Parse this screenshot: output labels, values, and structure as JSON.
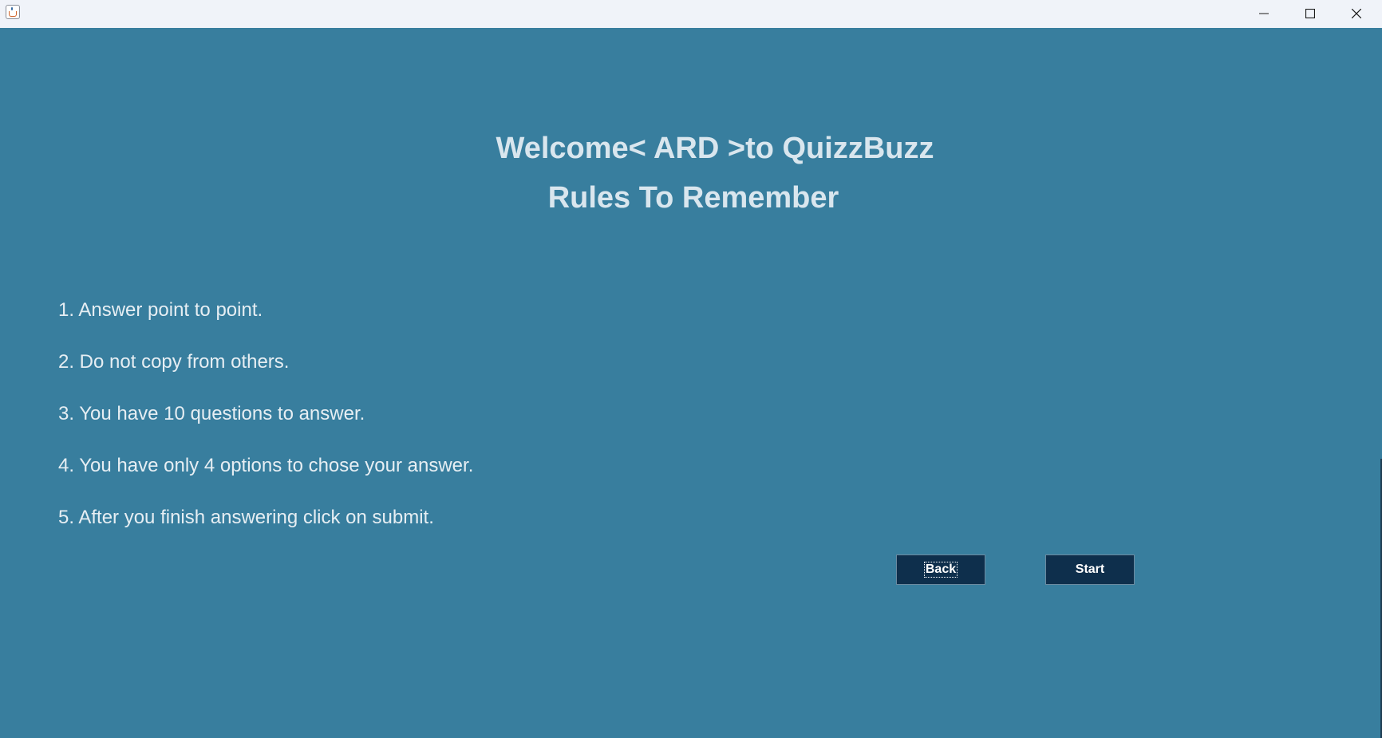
{
  "window": {
    "icon": "java-cup-icon",
    "controls": [
      "minimize-icon",
      "maximize-icon",
      "close-icon"
    ]
  },
  "main": {
    "welcome_text": "Welcome< ARD >to QuizzBuzz",
    "rules_heading": "Rules To Remember",
    "rules": [
      "1. Answer point to point.",
      "2. Do not copy from others.",
      "3. You have 10 questions to answer.",
      "4. You have only 4 options to chose your answer.",
      "5. After you finish answering click on submit."
    ]
  },
  "buttons": {
    "back_label": "Back",
    "start_label": "Start"
  },
  "colors": {
    "background": "#387e9e",
    "button": "#0e2f4c",
    "text": "#d9e6ee"
  }
}
